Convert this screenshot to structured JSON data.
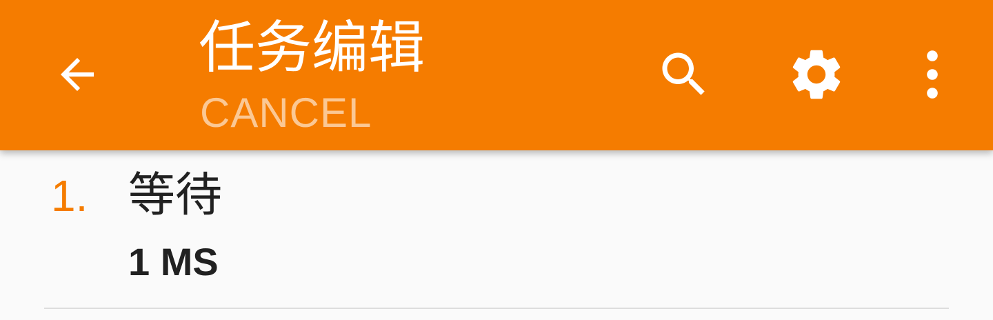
{
  "colors": {
    "accent": "#f57c00",
    "toolbar_text": "#ffffff",
    "body_text": "#212121",
    "background": "#fafafa"
  },
  "toolbar": {
    "title": "任务编辑",
    "subtitle": "CANCEL",
    "icons": [
      "back-arrow-icon",
      "search-icon",
      "settings-gear-icon",
      "more-vert-icon"
    ]
  },
  "tasks": [
    {
      "number": "1.",
      "name": "等待",
      "param": "1 MS"
    }
  ]
}
